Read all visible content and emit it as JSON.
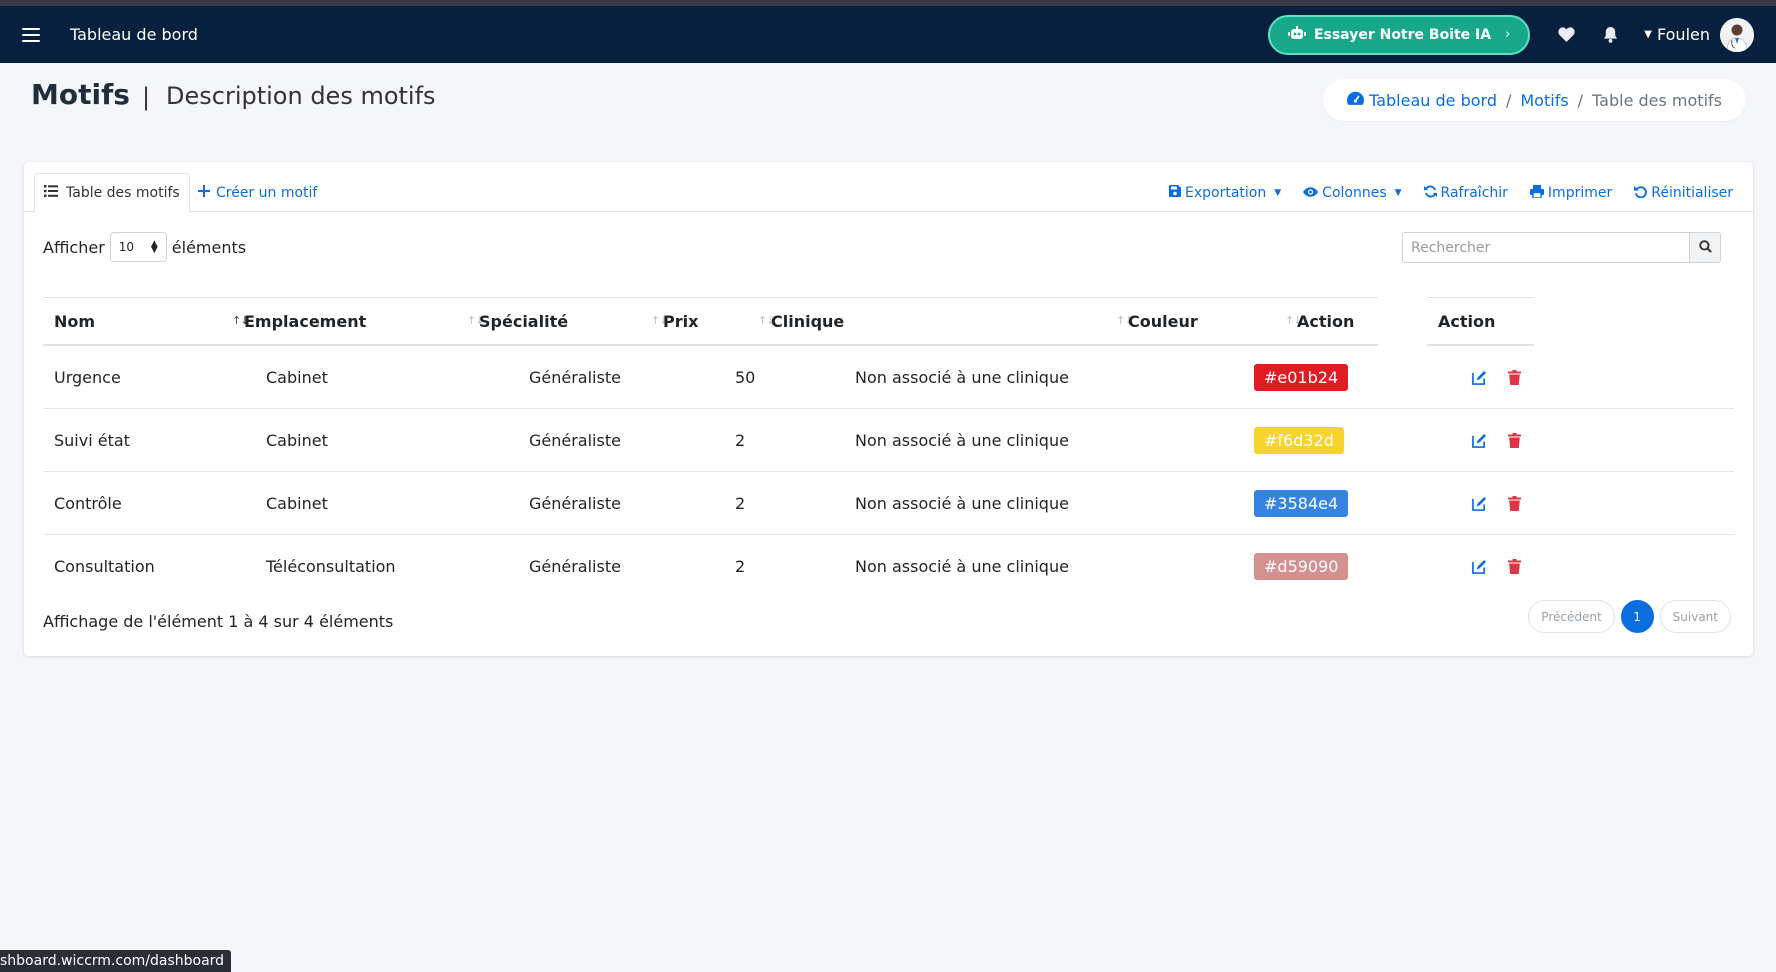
{
  "navbar": {
    "title": "Tableau de bord",
    "ia_button": "Essayer Notre Boite IA",
    "ia_chevron": "›",
    "user_name": "Foulen"
  },
  "page": {
    "title": "Motifs",
    "separator": "|",
    "subtitle": "Description des motifs"
  },
  "breadcrumb": {
    "home": "Tableau de bord",
    "sep1": "/",
    "motifs": "Motifs",
    "sep2": "/",
    "current": "Table des motifs"
  },
  "card": {
    "tab_table": "Table des motifs",
    "tab_create": "Créer un motif",
    "toolbar": {
      "export": "Exportation",
      "columns": "Colonnes",
      "refresh": "Rafraîchir",
      "print": "Imprimer",
      "reset": "Réinitialiser"
    },
    "length": {
      "before": "Afficher",
      "value": "10",
      "after": "éléments"
    },
    "search_placeholder": "Rechercher"
  },
  "table": {
    "headers": {
      "nom": "Nom",
      "emplacement": "Emplacement",
      "specialite": "Spécialité",
      "prix": "Prix",
      "clinique": "Clinique",
      "couleur": "Couleur",
      "action": "Action",
      "action2": "Action"
    },
    "sort_icon": "↑↓",
    "rows": [
      {
        "nom": "Urgence",
        "emplacement": "Cabinet",
        "specialite": "Généraliste",
        "prix": "50",
        "clinique": "Non associé à une clinique",
        "couleur": "#e01b24"
      },
      {
        "nom": "Suivi état",
        "emplacement": "Cabinet",
        "specialite": "Généraliste",
        "prix": "2",
        "clinique": "Non associé à une clinique",
        "couleur": "#f6d32d"
      },
      {
        "nom": "Contrôle",
        "emplacement": "Cabinet",
        "specialite": "Généraliste",
        "prix": "2",
        "clinique": "Non associé à une clinique",
        "couleur": "#3584e4"
      },
      {
        "nom": "Consultation",
        "emplacement": "Téléconsultation",
        "specialite": "Généraliste",
        "prix": "2",
        "clinique": "Non associé à une clinique",
        "couleur": "#d59090"
      }
    ]
  },
  "footer": {
    "info": "Affichage de l'élément 1 à 4 sur 4 éléments",
    "prev": "Précédent",
    "page": "1",
    "next": "Suivant"
  },
  "status_url": "shboard.wiccrm.com/dashboard",
  "colors": {
    "navbar": "#06203d",
    "accent": "#0b6ee0",
    "ia_button": "#17a88c",
    "delete": "#dc3545"
  }
}
